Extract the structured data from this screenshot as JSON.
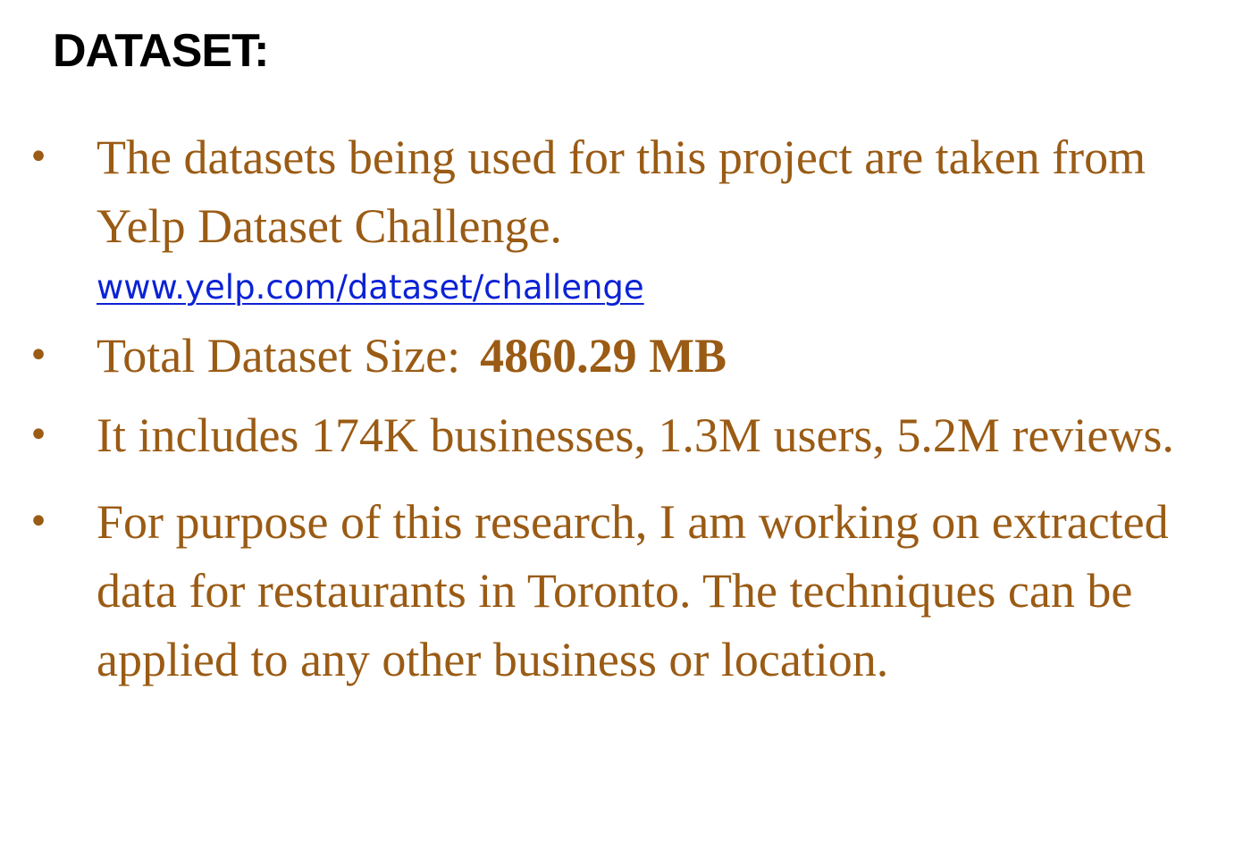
{
  "slide": {
    "title": "DATASET:",
    "bullets": [
      {
        "text": "The datasets being used for this project are taken from Yelp Dataset Challenge.",
        "link": "www.yelp.com/dataset/challenge"
      },
      {
        "label": "Total Dataset Size:",
        "value": "4860.29 MB"
      },
      {
        "text": "It includes 174K businesses, 1.3M users, 5.2M reviews."
      },
      {
        "text": "For purpose of this research, I am working on extracted data for restaurants in Toronto. The techniques can be applied to any other business or location."
      }
    ],
    "bullet_glyph": "•"
  },
  "colors": {
    "body_text": "#9a5b14",
    "title_text": "#000000",
    "link": "#0b22d6",
    "background": "#ffffff"
  }
}
